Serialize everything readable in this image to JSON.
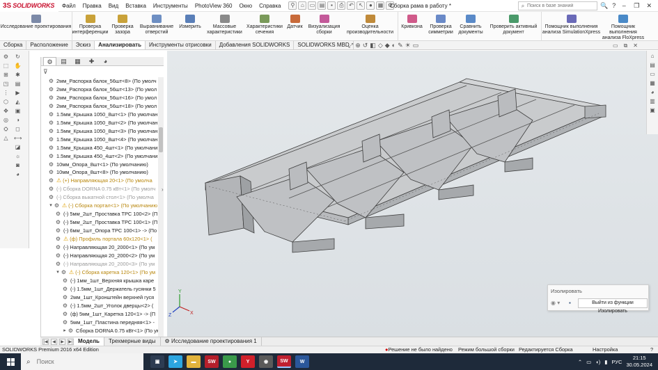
{
  "app": {
    "logo_mark": "3S",
    "logo_text": "SOLIDWORKS",
    "document_title": "Сборка рама в работу *"
  },
  "menu": [
    "Файл",
    "Правка",
    "Вид",
    "Вставка",
    "Инструменты",
    "PhotoView 360",
    "Окно",
    "Справка"
  ],
  "search": {
    "placeholder": "Поиск в базе знаний"
  },
  "ribbon": [
    {
      "label": "Исследование проектирования",
      "icon": "design-study-icon",
      "color": "#7c8aa8"
    },
    {
      "label": "Проверка\nинтерференции",
      "icon": "interference-icon",
      "color": "#c9a23a"
    },
    {
      "label": "Проверка\nзазора",
      "icon": "clearance-icon",
      "color": "#c9a23a"
    },
    {
      "label": "Выравнивание\nотверстий",
      "icon": "hole-alignment-icon",
      "color": "#6e8fc3"
    },
    {
      "label": "Измерить",
      "icon": "measure-icon",
      "color": "#5a7fb8"
    },
    {
      "label": "Массовые\nхарактеристики",
      "icon": "mass-properties-icon",
      "color": "#8a8a8a"
    },
    {
      "label": "Характеристики\nсечения",
      "icon": "section-properties-icon",
      "color": "#7a9a5a"
    },
    {
      "label": "Датчик",
      "icon": "sensor-icon",
      "color": "#c86a3a"
    },
    {
      "label": "Визуализация\nсборки",
      "icon": "assembly-visualization-icon",
      "color": "#c45a9a"
    },
    {
      "label": "Оценка\nпроизводительности",
      "icon": "performance-icon",
      "color": "#c08a3a"
    },
    {
      "label": "Кривизна",
      "icon": "curvature-icon",
      "color": "#d05a8a"
    },
    {
      "label": "Проверка\nсимметрии",
      "icon": "symmetry-icon",
      "color": "#6a8ac8"
    },
    {
      "label": "Сравнить\nдокументы",
      "icon": "compare-icon",
      "color": "#5a8ac8"
    },
    {
      "label": "Проверить активный документ",
      "icon": "check-document-icon",
      "color": "#4a9a6a"
    },
    {
      "label": "Помощник выполнения\nанализа SimulationXpress",
      "icon": "simulationxpress-icon",
      "color": "#6a6ab8"
    },
    {
      "label": "Помощник выполнения\nанализа FloXpress",
      "icon": "floxpress-icon",
      "color": "#4a8ac8"
    }
  ],
  "command_tabs": [
    {
      "label": "Сборка",
      "active": false
    },
    {
      "label": "Расположение",
      "active": false
    },
    {
      "label": "Эскиз",
      "active": false
    },
    {
      "label": "Анализировать",
      "active": true
    },
    {
      "label": "Инструменты отрисовки",
      "active": false
    },
    {
      "label": "Добавления SOLIDWORKS",
      "active": false
    },
    {
      "label": "SOLIDWORKS MBD",
      "active": false
    }
  ],
  "tree": [
    {
      "label": "2мм_Распорка балок_56шт<8> (По умолч",
      "indent": 0,
      "style": "normal",
      "warn": false
    },
    {
      "label": "2мм_Распорка балок_56шт<13> (По умол",
      "indent": 0,
      "style": "normal",
      "warn": false
    },
    {
      "label": "2мм_Распорка балок_56шт<16> (По умол",
      "indent": 0,
      "style": "normal",
      "warn": false
    },
    {
      "label": "2мм_Распорка балок_56шт<18> (По умол",
      "indent": 0,
      "style": "normal",
      "warn": false
    },
    {
      "label": "1.5мм_Крышка 1050_8шт<1> (По умолчан",
      "indent": 0,
      "style": "normal",
      "warn": false
    },
    {
      "label": "1.5мм_Крышка 1050_8шт<2> (По умолчан",
      "indent": 0,
      "style": "normal",
      "warn": false
    },
    {
      "label": "1.5мм_Крышка 1050_8шт<3> (По умолчан",
      "indent": 0,
      "style": "normal",
      "warn": false
    },
    {
      "label": "1.5мм_Крышка 1050_8шт<4> (По умолчан",
      "indent": 0,
      "style": "normal",
      "warn": false
    },
    {
      "label": "1.5мм_Крышка 450_4шт<1> (По умолчани",
      "indent": 0,
      "style": "normal",
      "warn": false
    },
    {
      "label": "1.5мм_Крышка 450_4шт<2> (По умолчани",
      "indent": 0,
      "style": "normal",
      "warn": false
    },
    {
      "label": "10мм_Опора_8шт<1> (По умолчанию)",
      "indent": 0,
      "style": "normal",
      "warn": false
    },
    {
      "label": "10мм_Опора_8шт<8> (По умолчанию)",
      "indent": 0,
      "style": "normal",
      "warn": false
    },
    {
      "label": "(+) Направляющая 20<1> (По умолча",
      "indent": 0,
      "style": "warn",
      "warn": true
    },
    {
      "label": "(-) Сборка DORNA 0.75 кВт<1> (По умолч",
      "indent": 0,
      "style": "gray",
      "warn": false
    },
    {
      "label": "(-) Сборка выкатной стол<1> (По умолча",
      "indent": 0,
      "style": "gray",
      "warn": false
    },
    {
      "label": "(-) Сборка портал<1> (По умолчанию",
      "indent": 0,
      "style": "warn",
      "warn": true,
      "expander": "▾"
    },
    {
      "label": "(-) 5мм_2шт_Проставка ТРС 100<2> (П",
      "indent": 1,
      "style": "normal",
      "warn": false
    },
    {
      "label": "(-) 5мм_2шт_Проставка ТРС 100<1> (П",
      "indent": 1,
      "style": "normal",
      "warn": false
    },
    {
      "label": "(-) 6мм_1шт_Опора ТРС 100<1> -> (По",
      "indent": 1,
      "style": "normal",
      "warn": false
    },
    {
      "label": "(ф) Профиль портала 60х120<1> (",
      "indent": 1,
      "style": "warn",
      "warn": true
    },
    {
      "label": "(-) Направляющая 20_2000<1> (По ум",
      "indent": 1,
      "style": "normal",
      "warn": false
    },
    {
      "label": "(-) Направляющая 20_2000<2> (По ум",
      "indent": 1,
      "style": "normal",
      "warn": false
    },
    {
      "label": "(-) Направляющая 20_2000<3> (По ум",
      "indent": 1,
      "style": "gray",
      "warn": false
    },
    {
      "label": "(-) Сборка каретка 120<1> (По ум",
      "indent": 1,
      "style": "warn",
      "warn": true,
      "expander": "▾"
    },
    {
      "label": "(-) 1мм_1шт_Верхняя крышка каре",
      "indent": 2,
      "style": "normal",
      "warn": false
    },
    {
      "label": "(-) 1.5мм_1шт_Держатель гусянки 5",
      "indent": 2,
      "style": "normal",
      "warn": false
    },
    {
      "label": "2мм_1шт_Кронштейн верхней гуся",
      "indent": 2,
      "style": "normal",
      "warn": false
    },
    {
      "label": "(-) 1.5мм_2шт_Уголок дверцы<2> (",
      "indent": 2,
      "style": "normal",
      "warn": false
    },
    {
      "label": "(ф) 5мм_1шт_Каретка 120<1> -> (П",
      "indent": 2,
      "style": "normal",
      "warn": false
    },
    {
      "label": "5мм_1шт_Пластина передняя<1> -",
      "indent": 2,
      "style": "normal",
      "warn": false
    },
    {
      "label": "Сборка DORNA 0.75 кВт<1> (По ум",
      "indent": 2,
      "style": "normal",
      "warn": false,
      "expander": "▸"
    }
  ],
  "isolate_popup": {
    "title": "Изолировать",
    "exit_label": "Выйти из функции Изолировать"
  },
  "bottom_tabs": [
    {
      "label": "Модель",
      "active": true
    },
    {
      "label": "Трехмерные виды",
      "active": false
    },
    {
      "label": "Исследование проектирования 1",
      "active": false
    }
  ],
  "status": {
    "edition": "SOLIDWORKS Premium 2016 x64 Edition",
    "error": "Решение не было найдено",
    "mode": "Режим большой сборки",
    "editing": "Редактируется Сборка",
    "units": "Настройка",
    "help": "?"
  },
  "taskbar": {
    "search_placeholder": "Поиск",
    "apps": [
      {
        "name": "task-view-app",
        "label": "▣",
        "color": "#2d3c52"
      },
      {
        "name": "telegram-app",
        "label": "➤",
        "color": "#2ca5e0"
      },
      {
        "name": "file-explorer-app",
        "label": "▬",
        "color": "#e2b33c"
      },
      {
        "name": "solidworks-app-1",
        "label": "SW",
        "color": "#b51f2b"
      },
      {
        "name": "chrome-app",
        "label": "●",
        "color": "#3a9a4a"
      },
      {
        "name": "yandex-browser-app",
        "label": "Y",
        "color": "#d0202a"
      },
      {
        "name": "photo-app",
        "label": "◉",
        "color": "#5a5a5a"
      },
      {
        "name": "solidworks-app-2",
        "label": "SW",
        "color": "#c02030",
        "active": true
      },
      {
        "name": "word-app",
        "label": "W",
        "color": "#2b579a"
      }
    ],
    "lang": "РУС",
    "time": "21:15",
    "date": "30.05.2024"
  }
}
